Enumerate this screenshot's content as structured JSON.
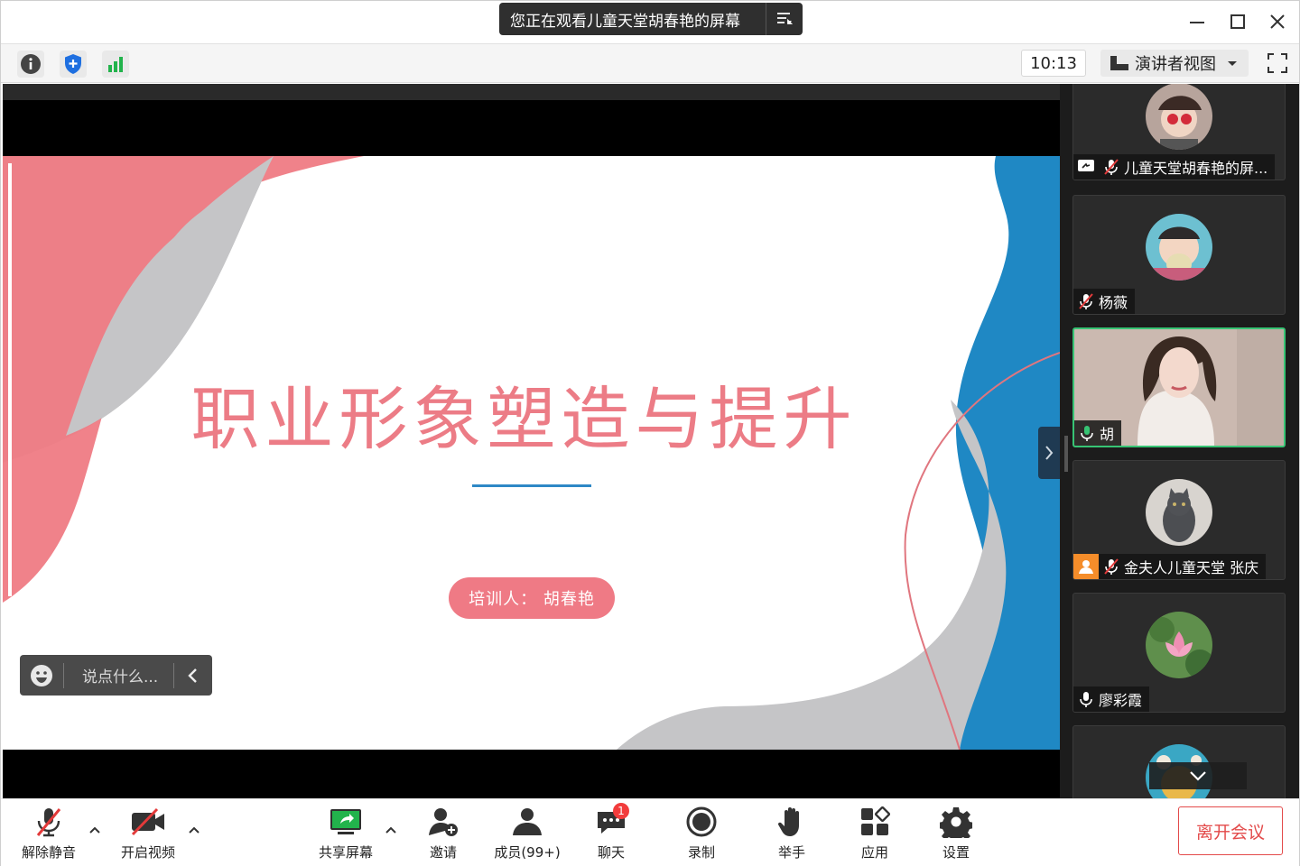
{
  "banner": {
    "text": "您正在观看儿童天堂胡春艳的屏幕"
  },
  "infobar": {
    "clock": "10:13",
    "view_label": "演讲者视图"
  },
  "slide": {
    "title": "职业形象塑造与提升",
    "trainer": "培训人： 胡春艳"
  },
  "chat_input": {
    "placeholder": "说点什么..."
  },
  "participants": [
    {
      "name": "儿童天堂胡春艳的屏...",
      "mic": "muted",
      "sharing": true
    },
    {
      "name": "杨薇",
      "mic": "muted"
    },
    {
      "name": "胡",
      "mic": "active",
      "active": true
    },
    {
      "name": "金夫人儿童天堂 张庆",
      "mic": "muted",
      "icon": "orange-user"
    },
    {
      "name": "廖彩霞",
      "mic": "on"
    }
  ],
  "toolbar": {
    "unmute": "解除静音",
    "start_video": "开启视频",
    "share_screen": "共享屏幕",
    "invite": "邀请",
    "members": "成员(99+)",
    "chat": "聊天",
    "chat_badge": "1",
    "record": "录制",
    "raise_hand": "举手",
    "apps": "应用",
    "settings": "设置",
    "leave": "离开会议"
  },
  "colors": {
    "accent_green": "#37c474",
    "leave_red": "#e34a4a",
    "slide_pink": "#ec7c86",
    "slide_blue": "#1f88c4"
  }
}
